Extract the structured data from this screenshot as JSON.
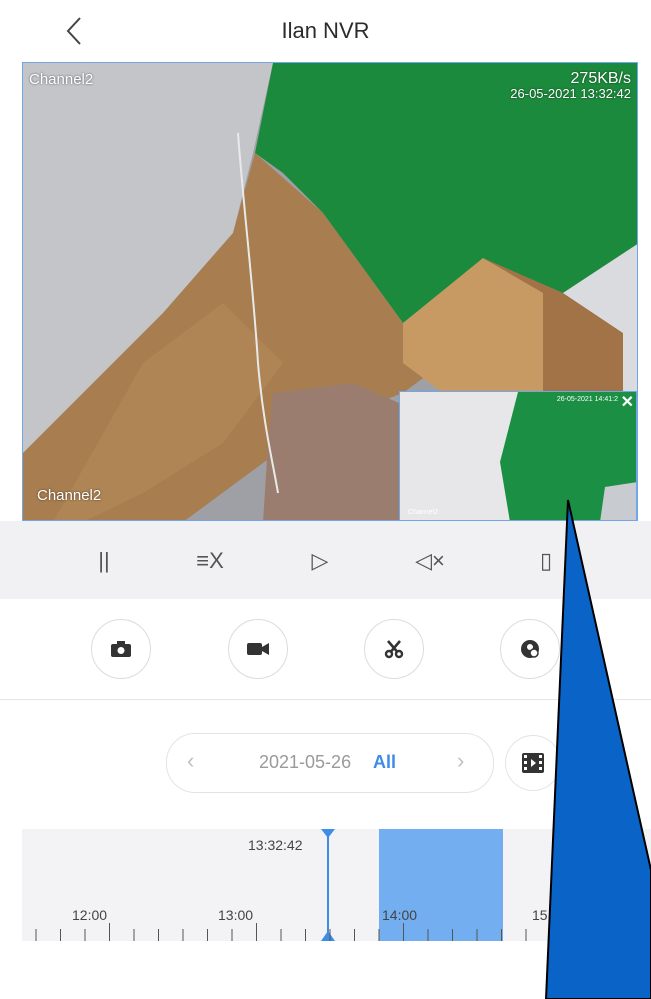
{
  "header": {
    "title": "Ilan NVR"
  },
  "video": {
    "channel_label_top": "Channel2",
    "channel_label_bottom": "Channel2",
    "bitrate": "275KB/s",
    "timestamp": "26-05-2021 13:32:42",
    "pip": {
      "timestamp": "26-05-2021 14:41:2",
      "channel": "Channel2",
      "close_label": "✕"
    }
  },
  "controls": {
    "pause": "||",
    "stream": "≡X",
    "speed": "▷",
    "mute": "◁×",
    "rotate": "▯"
  },
  "date_nav": {
    "prev": "‹",
    "next": "›",
    "date": "2021-05-26",
    "filter": "All"
  },
  "timeline": {
    "cursor_time": "13:32:42",
    "labels": [
      "12:00",
      "13:00",
      "14:00",
      "15"
    ]
  },
  "colors": {
    "accent": "#3d8ce8",
    "recording": "#72aef0",
    "annotation_arrow": "#0a64c8"
  }
}
